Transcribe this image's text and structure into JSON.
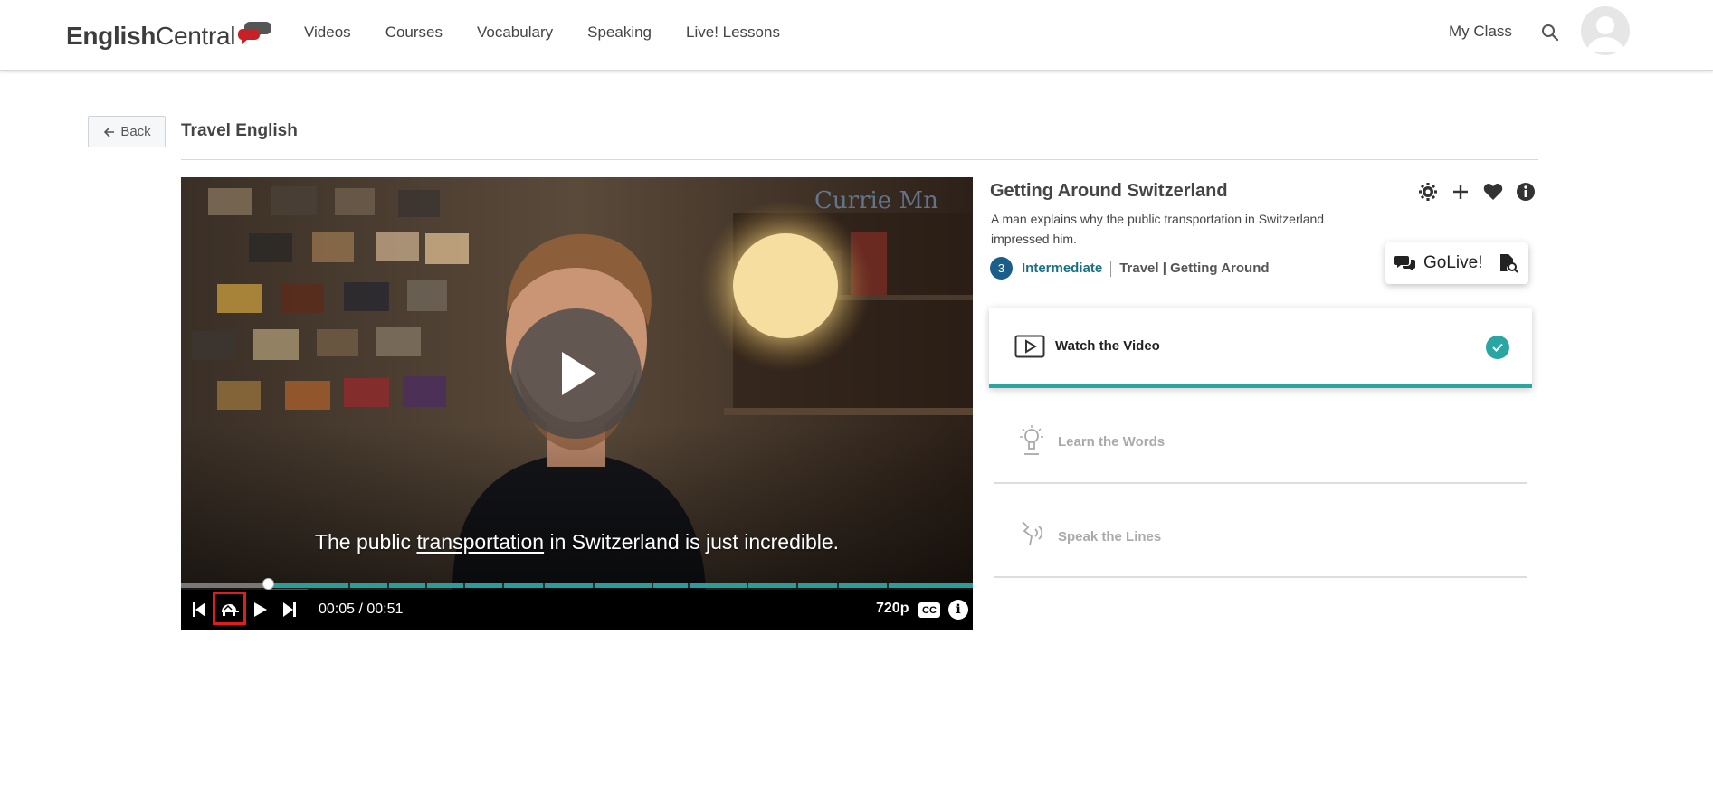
{
  "header": {
    "logo_english": "English",
    "logo_central": "Central",
    "nav": [
      "Videos",
      "Courses",
      "Vocabulary",
      "Speaking",
      "Live! Lessons"
    ],
    "my_class": "My Class"
  },
  "subheader": {
    "back_label": "Back",
    "course_title": "Travel English"
  },
  "player": {
    "caption_before": "The public ",
    "caption_word": "transportation",
    "caption_after": " in Switzerland is just incredible.",
    "time": "00:05 / 00:51",
    "quality": "720p",
    "cc": "CC",
    "info": "i",
    "progress_fraction": 0.11
  },
  "video": {
    "title": "Getting Around Switzerland",
    "description": "A man explains why the public transportation in Switzerland impressed him.",
    "level_number": "3",
    "level_name": "Intermediate",
    "topic": "Travel | Getting Around",
    "golive": "GoLive!"
  },
  "steps": [
    {
      "label": "Watch the Video",
      "done": true
    },
    {
      "label": "Learn the Words",
      "done": false
    },
    {
      "label": "Speak the Lines",
      "done": false
    }
  ],
  "colors": {
    "accent_teal": "#2aa5a1",
    "level_blue": "#1b5e8a",
    "highlight_red": "#e01e1e",
    "logo_red": "#c62127"
  }
}
